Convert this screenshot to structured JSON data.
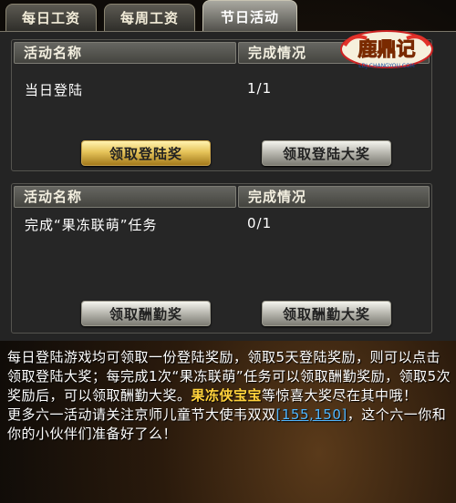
{
  "tabs": [
    {
      "label": "每日工资",
      "active": false
    },
    {
      "label": "每周工资",
      "active": false
    },
    {
      "label": "节日活动",
      "active": true
    }
  ],
  "table1": {
    "col_name": "活动名称",
    "col_status": "完成情况",
    "row_name": "当日登陆",
    "row_status": "1/1",
    "button_left": "领取登陆奖",
    "button_right": "领取登陆大奖"
  },
  "table2": {
    "col_name": "活动名称",
    "col_status": "完成情况",
    "row_name": "完成“果冻联萌”任务",
    "row_status": "0/1",
    "button_left": "领取酬勤奖",
    "button_right": "领取酬勤大奖"
  },
  "logo": {
    "title": "鹿鼎记",
    "subtitle": "LDJ.CHANGYOU.COM"
  },
  "description": {
    "p1": "每日登陆游戏均可领取一份登陆奖励，领取5天登陆奖励，则可以点击领取登陆大奖；每完成1次“果冻联萌”任务可以领取酬勤奖励，领取5次奖励后，可以领取酬勤大奖。",
    "highlight": "果冻侠宝宝",
    "p1_tail": "等惊喜大奖尽在其中哦！",
    "p2_before": "更多六一活动请关注京师儿童节大使韦双双",
    "coords": "[155,150]",
    "p2_after": "，这个六一你和你的小伙伴们准备好了么！"
  },
  "colors": {
    "highlight": "#ffd23c",
    "link": "#4fb6ff",
    "gold_button": "#e6c45a"
  }
}
